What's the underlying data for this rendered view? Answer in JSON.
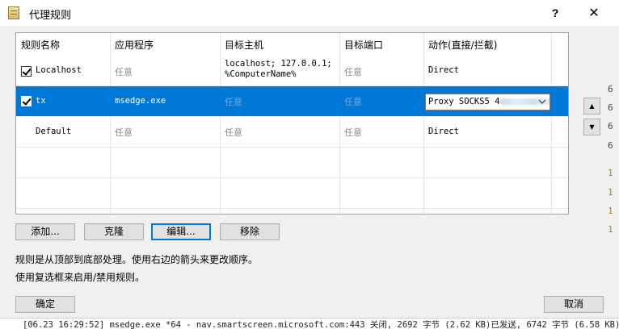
{
  "window": {
    "title": "代理规则",
    "help_label": "?",
    "close_label": "✕"
  },
  "table": {
    "columns": [
      "规则名称",
      "应用程序",
      "目标主机",
      "目标端口",
      "动作(直接/拦截)"
    ],
    "rows": [
      {
        "checked": true,
        "name": "Localhost",
        "app": "任意",
        "host_line1": "localhost; 127.0.0.1;",
        "host_line2": "%ComputerName%",
        "port": "任意",
        "action": "Direct",
        "selected": false
      },
      {
        "checked": true,
        "name": "tx",
        "app": "msedge.exe",
        "host_line1": "任意",
        "host_line2": "",
        "port": "任意",
        "action": "Proxy SOCKS5 4",
        "selected": true
      },
      {
        "checked": false,
        "name": "Default",
        "app": "任意",
        "host_line1": "任意",
        "host_line2": "",
        "port": "任意",
        "action": "Direct",
        "selected": false
      }
    ]
  },
  "side_buttons": {
    "up_label": "▲",
    "down_label": "▼"
  },
  "buttons": {
    "add": "添加...",
    "clone": "克隆",
    "edit": "编辑...",
    "remove": "移除",
    "ok": "确定",
    "cancel": "取消"
  },
  "hints": {
    "order": "规则是从顶部到底部处理。使用右边的箭头来更改顺序。",
    "checkbox": "使用复选框来启用/禁用规则。"
  },
  "background": {
    "log_line": "[06.23 16:29:52] msedge.exe *64 - nav.smartscreen.microsoft.com:443 关闭, 2692 字节 (2.62 KB)已发送, 6742 字节 (6.58 KB)已"
  },
  "icons": {
    "app": "rules-document-icon",
    "combo_arrow": "chevron-down-icon"
  }
}
